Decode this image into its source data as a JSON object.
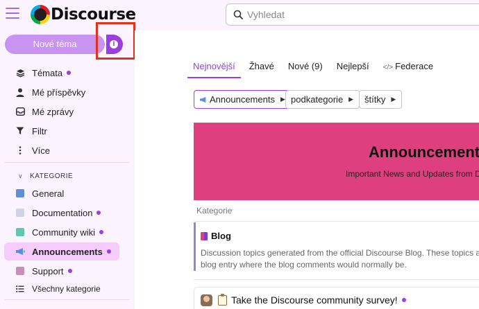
{
  "header": {
    "logo_text": "Discourse",
    "search_placeholder": "Vyhledat"
  },
  "sidebar": {
    "new_topic_label": "Nové téma",
    "info_glyph": "i",
    "nav": [
      {
        "label": "Témata",
        "icon": "layers-icon",
        "unread": true
      },
      {
        "label": "Mé příspěvky",
        "icon": "user-icon",
        "unread": false
      },
      {
        "label": "Mé zprávy",
        "icon": "inbox-icon",
        "unread": false
      },
      {
        "label": "Filtr",
        "icon": "filter-icon",
        "unread": false
      },
      {
        "label": "Více",
        "icon": "more-vertical-icon",
        "unread": false
      }
    ],
    "section_title": "KATEGORIE",
    "categories": [
      {
        "label": "General",
        "color": "#5b8fd6",
        "unread": false
      },
      {
        "label": "Documentation",
        "color": "#cfd3e6",
        "unread": true
      },
      {
        "label": "Community wiki",
        "color": "#5fc9b0",
        "unread": true
      },
      {
        "label": "Announcements",
        "color": "#5b8fd6",
        "unread": true,
        "active": true
      },
      {
        "label": "Support",
        "color": "#c98fb5",
        "unread": true
      }
    ],
    "all_categories_label": "Všechny kategorie"
  },
  "main": {
    "tabs": [
      {
        "label": "Nejnovější",
        "active": true
      },
      {
        "label": "Žhavé",
        "active": false
      },
      {
        "label": "Nové (9)",
        "active": false
      },
      {
        "label": "Nejlepší",
        "active": false
      },
      {
        "label": "Federace",
        "active": false
      }
    ],
    "filters": {
      "category": "Announcements",
      "subcategory": "podkategorie",
      "tags": "štítky"
    },
    "banner": {
      "title": "Announcement",
      "subtitle": "Important News and Updates from D",
      "color": "#de3f7f"
    },
    "category_column": "Kategorie",
    "category_row": {
      "name": "Blog",
      "description_line1": "Discussion topics generated from the official Discourse Blog. These topics a",
      "description_line2": "blog entry where the blog comments would normally be."
    },
    "topic_row": {
      "title": "Take the Discourse community survey!"
    }
  },
  "colors": {
    "accent": "#9a3ee0",
    "highlight_box": "#e0321a"
  }
}
